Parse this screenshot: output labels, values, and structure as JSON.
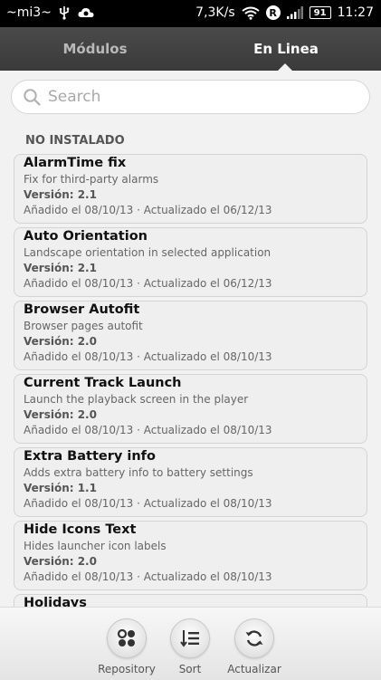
{
  "status_bar": {
    "carrier": "~mi3~",
    "speed": "7,3K/s",
    "roaming": "R",
    "battery": "91",
    "time": "11:27"
  },
  "tabs": [
    {
      "label": "Módulos",
      "active": false
    },
    {
      "label": "En Linea",
      "active": true
    }
  ],
  "search": {
    "placeholder": "Search"
  },
  "section_header": "NO INSTALADO",
  "modules": [
    {
      "title": "AlarmTime fix",
      "description": "Fix for third-party alarms",
      "version": "Versión: 2.1",
      "dates": "Añadido el 08/10/13 · Actualizado el 06/12/13"
    },
    {
      "title": "Auto Orientation",
      "description": "Landscape orientation in selected application",
      "version": "Versión: 2.1",
      "dates": "Añadido el 08/10/13 · Actualizado el 06/12/13"
    },
    {
      "title": "Browser Autofit",
      "description": "Browser pages autofit",
      "version": "Versión: 2.0",
      "dates": "Añadido el 08/10/13 · Actualizado el 08/10/13"
    },
    {
      "title": "Current Track Launch",
      "description": "Launch the playback screen in the player",
      "version": "Versión: 2.0",
      "dates": "Añadido el 08/10/13 · Actualizado el 08/10/13"
    },
    {
      "title": "Extra Battery info",
      "description": "Adds extra battery info to battery settings",
      "version": "Versión: 1.1",
      "dates": "Añadido el 08/10/13 · Actualizado el 08/10/13"
    },
    {
      "title": "Hide Icons Text",
      "description": "Hides launcher icon labels",
      "version": "Versión: 2.0",
      "dates": "Añadido el 08/10/13 · Actualizado el 08/10/13"
    },
    {
      "title": "Holidays",
      "description": "",
      "version": "",
      "dates": ""
    }
  ],
  "bottom_bar": {
    "repository": "Repository",
    "sort": "Sort",
    "refresh": "Actualizar"
  },
  "colors": {
    "status_bar_bg": "#000000",
    "tab_bar_bg": "#404040",
    "page_bg": "#f2f2f2",
    "card_bg": "#efefef"
  }
}
